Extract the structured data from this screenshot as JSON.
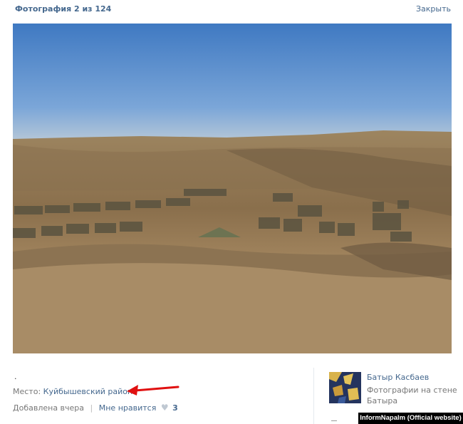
{
  "header": {
    "title": "Фотография 2 из 124",
    "close_label": "Закрыть"
  },
  "photo": {
    "description": ""
  },
  "info": {
    "dot": ".",
    "place_prefix": "Место:",
    "place_link": "Куйбышевский район",
    "added": "Добавлена вчера",
    "separator": "|",
    "like_label": "Мне нравится",
    "like_count": "3"
  },
  "author": {
    "name": "Батыр Касбаев",
    "album_text": "Фотографии на стене Батыра"
  },
  "watermark": {
    "text": "InformNapalm (Official website)"
  },
  "colors": {
    "link": "#45688e",
    "arrow": "#e01010",
    "sky": "#4f84c6"
  }
}
